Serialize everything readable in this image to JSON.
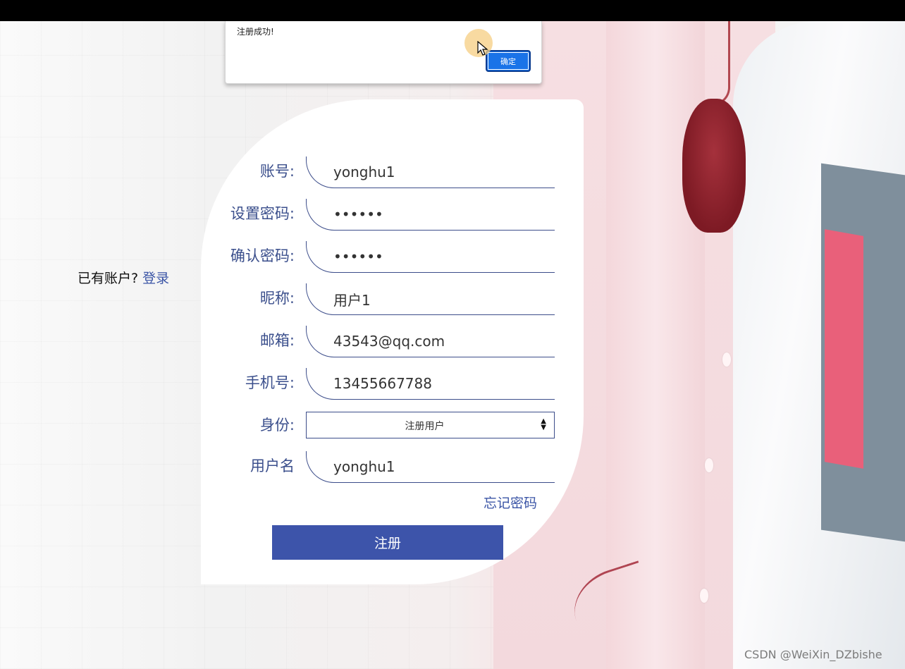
{
  "dialog": {
    "message": "注册成功!",
    "ok_label": "确定"
  },
  "login_prompt": {
    "text": "已有账户?",
    "link": "登录"
  },
  "form": {
    "account": {
      "label": "账号:",
      "value": "yonghu1"
    },
    "password": {
      "label": "设置密码:",
      "value": "••••••"
    },
    "confirm_password": {
      "label": "确认密码:",
      "value": "••••••"
    },
    "nickname": {
      "label": "昵称:",
      "value": "用户1"
    },
    "email": {
      "label": "邮箱:",
      "value": "43543@qq.com"
    },
    "phone": {
      "label": "手机号:",
      "value": "13455667788"
    },
    "role": {
      "label": "身份:",
      "selected": "注册用户"
    },
    "username": {
      "label": "用户名",
      "value": "yonghu1"
    },
    "forgot_label": "忘记密码",
    "submit_label": "注册"
  },
  "watermark": "CSDN @WeiXin_DZbishe",
  "colors": {
    "accent": "#3d54aa",
    "label": "#3b4f8c",
    "dialog_button": "#1a73e8"
  }
}
